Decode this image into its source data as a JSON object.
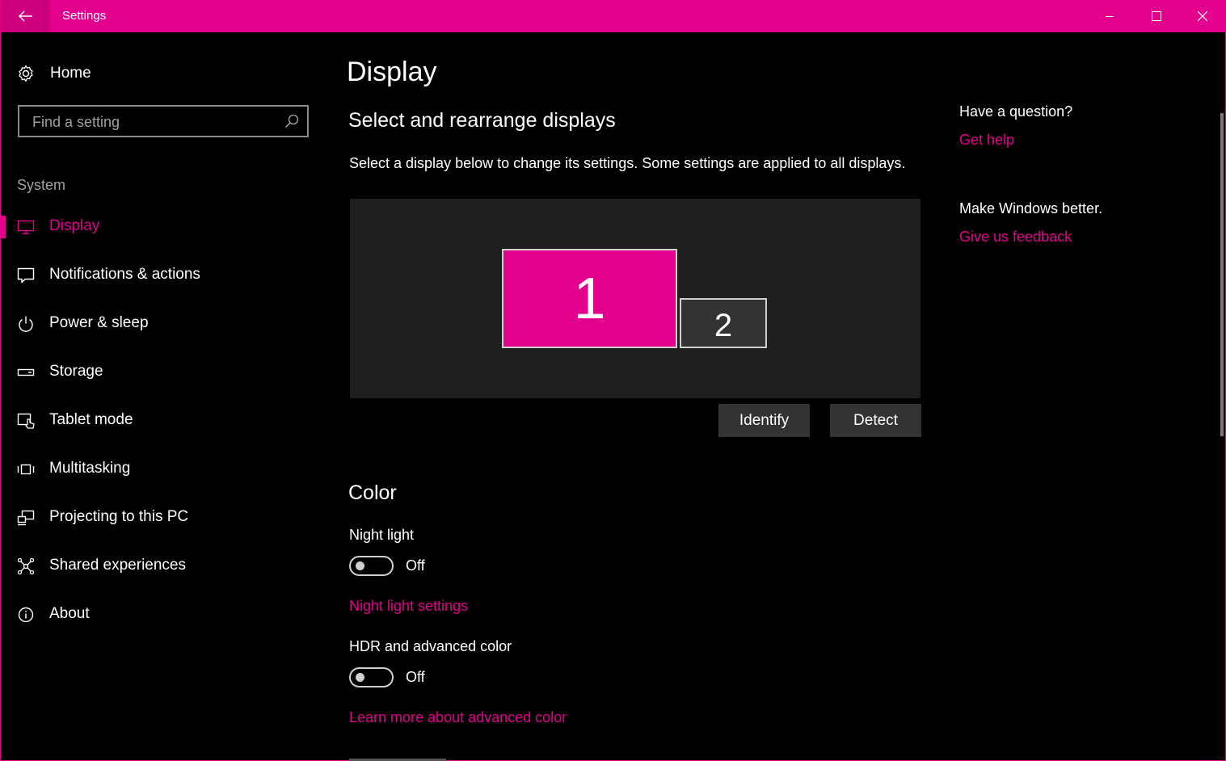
{
  "window": {
    "title": "Settings",
    "accent": "#e3008c"
  },
  "sidebar": {
    "home_label": "Home",
    "search_placeholder": "Find a setting",
    "section": "System",
    "items": [
      {
        "label": "Display",
        "icon": "monitor-icon",
        "selected": true
      },
      {
        "label": "Notifications & actions",
        "icon": "notification-icon"
      },
      {
        "label": "Power & sleep",
        "icon": "power-icon"
      },
      {
        "label": "Storage",
        "icon": "storage-icon"
      },
      {
        "label": "Tablet mode",
        "icon": "tablet-mode-icon"
      },
      {
        "label": "Multitasking",
        "icon": "multitasking-icon"
      },
      {
        "label": "Projecting to this PC",
        "icon": "projecting-icon"
      },
      {
        "label": "Shared experiences",
        "icon": "shared-experiences-icon"
      },
      {
        "label": "About",
        "icon": "info-icon"
      }
    ]
  },
  "main": {
    "title": "Display",
    "arrange": {
      "heading": "Select and rearrange displays",
      "description": "Select a display below to change its settings. Some settings are applied to all displays.",
      "display1": "1",
      "display2": "2",
      "identify_label": "Identify",
      "detect_label": "Detect"
    },
    "color": {
      "heading": "Color",
      "night_light_label": "Night light",
      "night_light_state": "Off",
      "night_light_link": "Night light settings",
      "hdr_label": "HDR and advanced color",
      "hdr_state": "Off",
      "hdr_link": "Learn more about advanced color"
    }
  },
  "aside": {
    "question": "Have a question?",
    "get_help": "Get help",
    "better": "Make Windows better.",
    "feedback": "Give us feedback"
  }
}
